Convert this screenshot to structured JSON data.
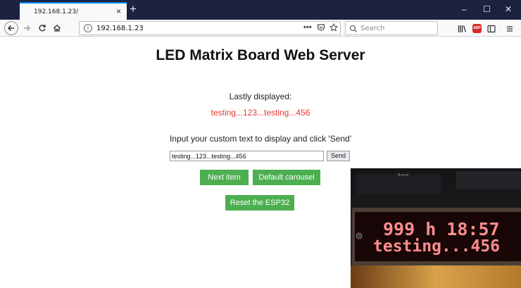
{
  "browser": {
    "tab_title": "192.168.1.23/",
    "tab_close": "×",
    "new_tab": "+",
    "window_controls": {
      "minimize": "–",
      "maximize": "☐",
      "close": "✕"
    },
    "url": "192.168.1.23",
    "search_placeholder": "Search",
    "adblock_label": "ABP"
  },
  "page": {
    "title": "LED Matrix Board Web Server",
    "last_label": "Lastly displayed:",
    "last_value": "testing...123...testing...456",
    "instruction": "Input your custom text to display and click 'Send'",
    "input_value": "testing...123...testing...456",
    "send_label": "Send",
    "next_label": "Next item",
    "carousel_label": "Default carousel",
    "reset_label": "Reset the ESP32",
    "colors": {
      "value_red": "#e53935",
      "button_green": "#4caf50"
    }
  },
  "photo": {
    "brand_label": "Brand",
    "led_line1": "999 h 18:57",
    "led_line2": "testing...456"
  }
}
